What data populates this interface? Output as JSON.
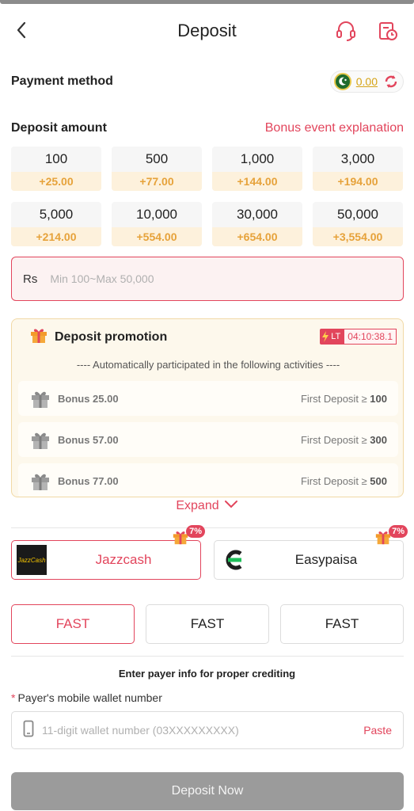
{
  "header": {
    "title": "Deposit"
  },
  "payment_method": {
    "label": "Payment method",
    "balance": "0.00"
  },
  "deposit_amount": {
    "label": "Deposit amount",
    "bonus_link": "Bonus event explanation"
  },
  "amounts": [
    {
      "value": "100",
      "bonus": "+25.00"
    },
    {
      "value": "500",
      "bonus": "+77.00"
    },
    {
      "value": "1,000",
      "bonus": "+144.00"
    },
    {
      "value": "3,000",
      "bonus": "+194.00"
    },
    {
      "value": "5,000",
      "bonus": "+214.00"
    },
    {
      "value": "10,000",
      "bonus": "+554.00"
    },
    {
      "value": "30,000",
      "bonus": "+654.00"
    },
    {
      "value": "50,000",
      "bonus": "+3,554.00"
    }
  ],
  "amount_input": {
    "currency": "Rs",
    "placeholder": "Min 100~Max 50,000"
  },
  "promotion": {
    "title": "Deposit promotion",
    "lt_label": "LT",
    "timer": "04:10:38.1",
    "auto_text": "---- Automatically participated in the following activities ----",
    "items": [
      {
        "bonus": "Bonus 25.00",
        "cond": "First Deposit ≥ ",
        "amount": "100"
      },
      {
        "bonus": "Bonus 57.00",
        "cond": "First Deposit ≥ ",
        "amount": "300"
      },
      {
        "bonus": "Bonus 77.00",
        "cond": "First Deposit ≥ ",
        "amount": "500"
      }
    ],
    "expand_label": "Expand"
  },
  "channels": [
    {
      "name": "Jazzcash",
      "percent": "7%",
      "logo_text": "JazzCash"
    },
    {
      "name": "Easypaisa",
      "percent": "7%"
    }
  ],
  "speed_options": [
    "FAST",
    "FAST",
    "FAST"
  ],
  "payer": {
    "hint": "Enter payer info for proper crediting",
    "required_mark": "*",
    "label": "Payer's mobile wallet number",
    "placeholder": "11-digit wallet number (03XXXXXXXXX)",
    "paste_label": "Paste"
  },
  "submit_label": "Deposit Now",
  "colors": {
    "accent": "#e2455c",
    "gold": "#e6a23a",
    "disabled": "#9b9b9b"
  }
}
